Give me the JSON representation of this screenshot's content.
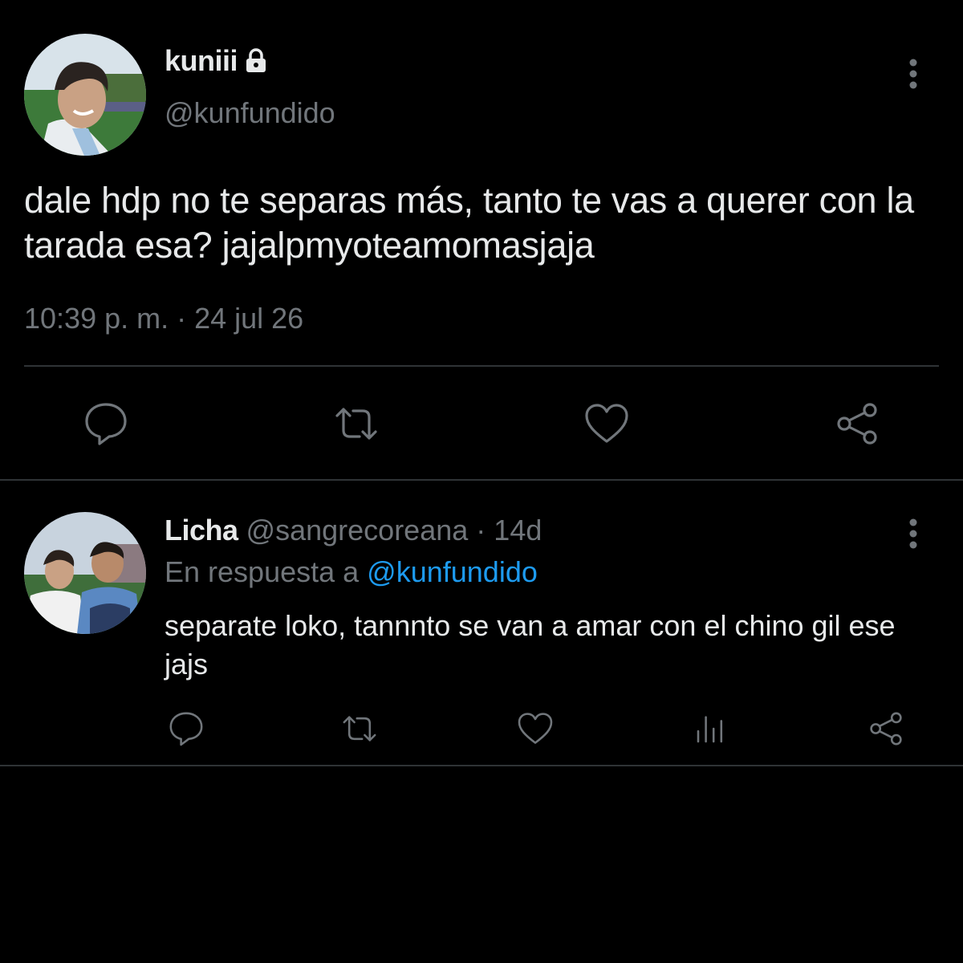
{
  "main_tweet": {
    "display_name": "kuniii",
    "protected_icon": "lock-icon",
    "handle": "@kunfundido",
    "text": "dale hdp no te separas más, tanto te vas a querer con la tarada esa? jajalpmyoteamomasjaja",
    "timestamp": "10:39 p. m. · 24 jul 26",
    "more_icon": "more-vertical-icon",
    "actions": [
      "reply-icon",
      "retweet-icon",
      "like-icon",
      "share-icon"
    ]
  },
  "reply_tweet": {
    "display_name": "Licha",
    "handle": "@sangrecoreana",
    "separator": "·",
    "time": "14d",
    "reply_context_prefix": "En respuesta a",
    "reply_context_mention": "@kunfundido",
    "text": "separate loko, tannnto se van a amar con el chino gil ese jajs",
    "more_icon": "more-vertical-icon",
    "actions": [
      "reply-icon",
      "retweet-icon",
      "like-icon",
      "analytics-icon",
      "share-icon"
    ]
  },
  "colors": {
    "background": "#000000",
    "text_primary": "#e7e9ea",
    "text_secondary": "#71767b",
    "divider": "#2f3336",
    "accent": "#1d9bf0"
  }
}
